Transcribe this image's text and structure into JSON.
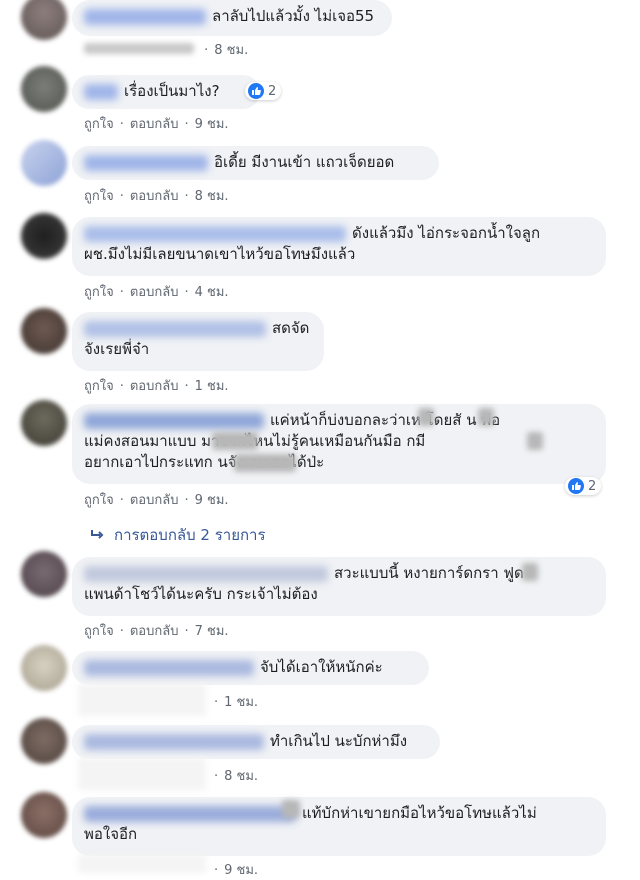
{
  "comments": [
    {
      "text": "ลาลับไปแล้วมั้ง ไม่เจอ55",
      "like": "",
      "reply": "",
      "time": "8 ชม."
    },
    {
      "text": "เรื่องเป็นมาไง?",
      "like": "ถูกใจ",
      "reply": "ตอบกลับ",
      "time": "9 ชม.",
      "reactions": "2"
    },
    {
      "text": "อิเดี้ย มีงานเข้า แถวเจ็ดยอด",
      "like": "ถูกใจ",
      "reply": "ตอบกลับ",
      "time": "8 ชม."
    },
    {
      "line1": "ดังแล้วมึง ไอ่กระจอกน้ำใจลูก",
      "line2": "ผช.มึงไม่มีเลยขนาดเขาไหว้ขอโทษมึงแล้ว",
      "like": "ถูกใจ",
      "reply": "ตอบกลับ",
      "time": "4 ชม."
    },
    {
      "line1": "สดจัด",
      "line2": "จังเรยพี่จ๋า",
      "like": "ถูกใจ",
      "reply": "ตอบกลับ",
      "time": "1 ชม."
    },
    {
      "line1": "แค่หน้าก็บ่งบอกละว่าเห โดยสั น พ่อ",
      "line2": "แม่คงสอนมาแบบ มาจากไหนไม่รู้คนเหมือนกันมือ กมี",
      "line3": "อยากเอาไปกระแทก นจังเลย ฮาได้ป่ะ",
      "like": "ถูกใจ",
      "reply": "ตอบกลับ",
      "time": "9 ชม.",
      "reactions": "2"
    },
    {
      "line1": "สวะแบบนี้ หงายการ์ดกรา ฟูด",
      "line2": "แพนด้าโชว์ได้นะครับ กระเจ้าไม่ต้อง",
      "like": "ถูกใจ",
      "reply": "ตอบกลับ",
      "time": "7 ชม."
    },
    {
      "text": "จับได้เอาให้หนักค่ะ",
      "like": "",
      "reply": "",
      "time": "1 ชม."
    },
    {
      "text": "ทำเกินไป นะบักห่ามึง",
      "like": "",
      "reply": "",
      "time": "8 ชม."
    },
    {
      "line1": "แท้บักห่าเขายกมือไหว้ขอโทษแล้วไม่",
      "line2": "พอใจอีก",
      "like": "",
      "reply": "",
      "time": "9 ชม."
    }
  ],
  "replies_link": "การตอบกลับ 2 รายการ",
  "icons": {
    "reply_arrow": "reply-arrow-icon",
    "like": "like-icon"
  },
  "colors": {
    "bubble": "#f0f2f5",
    "link": "#385898",
    "like_blue": "#2078f4"
  }
}
